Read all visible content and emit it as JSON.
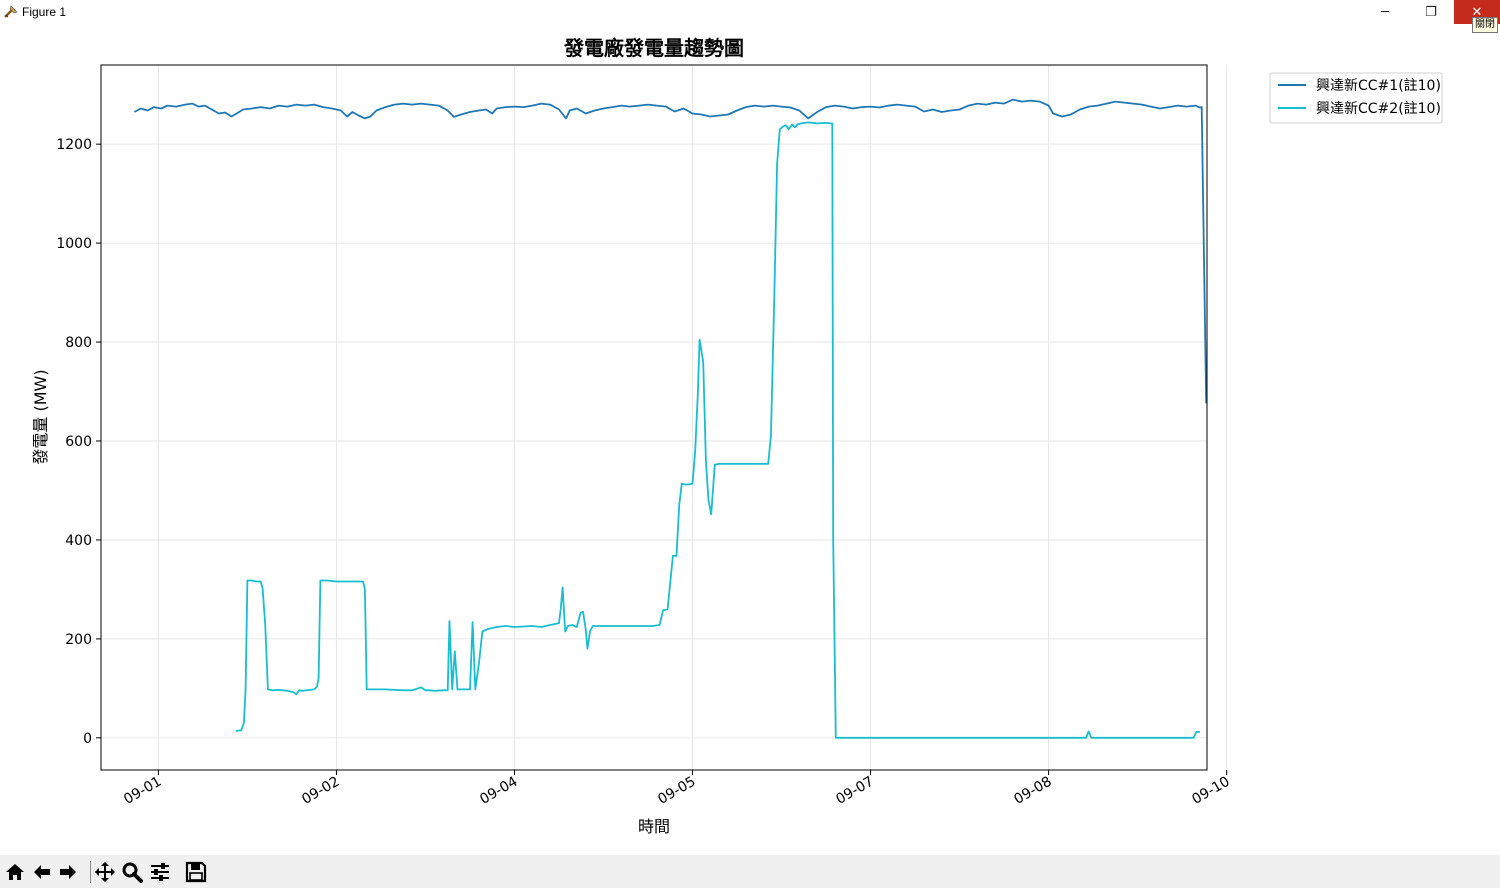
{
  "window": {
    "title": "Figure 1",
    "minimize_glyph": "─",
    "maximize_glyph": "❐",
    "close_glyph": "✕",
    "close_tooltip": "關閉"
  },
  "toolbar": {
    "buttons": [
      "home-icon",
      "back-arrow-icon",
      "forward-arrow-icon",
      "pan-icon",
      "zoom-icon",
      "configure-subplots-icon",
      "save-icon"
    ]
  },
  "chart_data": {
    "type": "line",
    "title": "發電廠發電量趨勢圖",
    "xlabel": "時間",
    "ylabel": "發電量 (MW)",
    "x_unit": "days from 2023-09-01 00:00 (x-axis labels show month-day)",
    "xlim": [
      -0.52,
      9.5
    ],
    "ylim": [
      -65,
      1360
    ],
    "grid": true,
    "legend_position": "upper right outside",
    "xticks": [
      {
        "value": 0,
        "label": "09-01"
      },
      {
        "value": 2,
        "label": "09-02"
      },
      {
        "value": 4,
        "label": "09-04"
      },
      {
        "value": 6,
        "label": "09-05"
      },
      {
        "value": 8,
        "label": "09-07"
      },
      {
        "value": 10,
        "label": "09-08"
      },
      {
        "value": 12,
        "label": "09-10"
      }
    ],
    "yticks": [
      0,
      200,
      400,
      600,
      800,
      1000,
      1200
    ],
    "series": [
      {
        "name": "興達新CC#1(註10)",
        "color": "#1f77b4",
        "points": [
          [
            -0.27,
            1265
          ],
          [
            -0.2,
            1272
          ],
          [
            -0.12,
            1268
          ],
          [
            -0.05,
            1275
          ],
          [
            0.03,
            1272
          ],
          [
            0.1,
            1278
          ],
          [
            0.2,
            1276
          ],
          [
            0.3,
            1280
          ],
          [
            0.38,
            1282
          ],
          [
            0.45,
            1276
          ],
          [
            0.52,
            1278
          ],
          [
            0.6,
            1270
          ],
          [
            0.68,
            1262
          ],
          [
            0.75,
            1264
          ],
          [
            0.82,
            1256
          ],
          [
            0.88,
            1262
          ],
          [
            0.95,
            1270
          ],
          [
            1.05,
            1272
          ],
          [
            1.15,
            1275
          ],
          [
            1.25,
            1272
          ],
          [
            1.35,
            1278
          ],
          [
            1.45,
            1276
          ],
          [
            1.55,
            1280
          ],
          [
            1.65,
            1278
          ],
          [
            1.75,
            1280
          ],
          [
            1.85,
            1275
          ],
          [
            1.95,
            1272
          ],
          [
            2.05,
            1268
          ],
          [
            2.12,
            1256
          ],
          [
            2.18,
            1265
          ],
          [
            2.25,
            1258
          ],
          [
            2.32,
            1252
          ],
          [
            2.38,
            1256
          ],
          [
            2.45,
            1268
          ],
          [
            2.55,
            1275
          ],
          [
            2.65,
            1280
          ],
          [
            2.75,
            1282
          ],
          [
            2.85,
            1280
          ],
          [
            2.95,
            1282
          ],
          [
            3.05,
            1280
          ],
          [
            3.15,
            1278
          ],
          [
            3.25,
            1268
          ],
          [
            3.32,
            1255
          ],
          [
            3.4,
            1260
          ],
          [
            3.5,
            1265
          ],
          [
            3.6,
            1268
          ],
          [
            3.68,
            1270
          ],
          [
            3.75,
            1262
          ],
          [
            3.8,
            1272
          ],
          [
            3.9,
            1275
          ],
          [
            4.0,
            1276
          ],
          [
            4.1,
            1275
          ],
          [
            4.2,
            1278
          ],
          [
            4.3,
            1282
          ],
          [
            4.4,
            1280
          ],
          [
            4.5,
            1270
          ],
          [
            4.58,
            1252
          ],
          [
            4.62,
            1268
          ],
          [
            4.7,
            1272
          ],
          [
            4.8,
            1262
          ],
          [
            4.9,
            1268
          ],
          [
            5.0,
            1272
          ],
          [
            5.1,
            1275
          ],
          [
            5.2,
            1278
          ],
          [
            5.3,
            1276
          ],
          [
            5.4,
            1278
          ],
          [
            5.5,
            1280
          ],
          [
            5.6,
            1278
          ],
          [
            5.7,
            1276
          ],
          [
            5.8,
            1266
          ],
          [
            5.9,
            1272
          ],
          [
            6.0,
            1262
          ],
          [
            6.1,
            1260
          ],
          [
            6.2,
            1256
          ],
          [
            6.3,
            1258
          ],
          [
            6.4,
            1260
          ],
          [
            6.5,
            1268
          ],
          [
            6.6,
            1275
          ],
          [
            6.7,
            1278
          ],
          [
            6.8,
            1276
          ],
          [
            6.9,
            1278
          ],
          [
            7.0,
            1276
          ],
          [
            7.1,
            1274
          ],
          [
            7.2,
            1268
          ],
          [
            7.3,
            1252
          ],
          [
            7.4,
            1265
          ],
          [
            7.5,
            1275
          ],
          [
            7.6,
            1278
          ],
          [
            7.7,
            1276
          ],
          [
            7.8,
            1272
          ],
          [
            7.9,
            1275
          ],
          [
            8.0,
            1276
          ],
          [
            8.1,
            1274
          ],
          [
            8.2,
            1278
          ],
          [
            8.3,
            1280
          ],
          [
            8.4,
            1278
          ],
          [
            8.5,
            1276
          ],
          [
            8.6,
            1266
          ],
          [
            8.7,
            1270
          ],
          [
            8.8,
            1265
          ],
          [
            8.9,
            1268
          ],
          [
            9.0,
            1270
          ],
          [
            9.1,
            1278
          ],
          [
            9.2,
            1282
          ],
          [
            9.3,
            1280
          ],
          [
            9.4,
            1284
          ],
          [
            9.5,
            1282
          ],
          [
            9.6,
            1290
          ],
          [
            9.7,
            1286
          ],
          [
            9.8,
            1288
          ],
          [
            9.9,
            1286
          ],
          [
            10.0,
            1278
          ],
          [
            10.05,
            1262
          ],
          [
            10.15,
            1256
          ],
          [
            10.25,
            1260
          ],
          [
            10.35,
            1270
          ],
          [
            10.45,
            1276
          ],
          [
            10.55,
            1278
          ],
          [
            10.65,
            1282
          ],
          [
            10.75,
            1286
          ],
          [
            10.85,
            1284
          ],
          [
            10.95,
            1282
          ],
          [
            11.05,
            1280
          ],
          [
            11.15,
            1276
          ],
          [
            11.25,
            1272
          ],
          [
            11.35,
            1275
          ],
          [
            11.45,
            1278
          ],
          [
            11.55,
            1276
          ],
          [
            11.65,
            1278
          ],
          [
            11.7,
            1274
          ],
          [
            11.72,
            1275
          ],
          [
            11.77,
            676
          ]
        ]
      },
      {
        "name": "興達新CC#2(註10)",
        "color": "#17becf",
        "points": [
          [
            0.87,
            14
          ],
          [
            0.93,
            15
          ],
          [
            0.96,
            30
          ],
          [
            0.98,
            100
          ],
          [
            1.0,
            318
          ],
          [
            1.05,
            318
          ],
          [
            1.1,
            316
          ],
          [
            1.15,
            316
          ],
          [
            1.17,
            302
          ],
          [
            1.2,
            230
          ],
          [
            1.23,
            98
          ],
          [
            1.28,
            96
          ],
          [
            1.35,
            97
          ],
          [
            1.45,
            95
          ],
          [
            1.52,
            92
          ],
          [
            1.55,
            88
          ],
          [
            1.58,
            96
          ],
          [
            1.62,
            95
          ],
          [
            1.7,
            97
          ],
          [
            1.75,
            98
          ],
          [
            1.78,
            103
          ],
          [
            1.8,
            120
          ],
          [
            1.82,
            318
          ],
          [
            1.9,
            318
          ],
          [
            2.0,
            316
          ],
          [
            2.1,
            316
          ],
          [
            2.2,
            316
          ],
          [
            2.25,
            316
          ],
          [
            2.3,
            316
          ],
          [
            2.32,
            300
          ],
          [
            2.34,
            98
          ],
          [
            2.45,
            98
          ],
          [
            2.55,
            98
          ],
          [
            2.65,
            97
          ],
          [
            2.75,
            96
          ],
          [
            2.85,
            96
          ],
          [
            2.95,
            102
          ],
          [
            3.0,
            96
          ],
          [
            3.05,
            96
          ],
          [
            3.1,
            95
          ],
          [
            3.2,
            96
          ],
          [
            3.25,
            96
          ],
          [
            3.27,
            236
          ],
          [
            3.3,
            98
          ],
          [
            3.33,
            175
          ],
          [
            3.36,
            98
          ],
          [
            3.42,
            98
          ],
          [
            3.48,
            98
          ],
          [
            3.5,
            98
          ],
          [
            3.53,
            234
          ],
          [
            3.56,
            98
          ],
          [
            3.6,
            150
          ],
          [
            3.64,
            215
          ],
          [
            3.7,
            220
          ],
          [
            3.8,
            224
          ],
          [
            3.9,
            226
          ],
          [
            4.0,
            224
          ],
          [
            4.1,
            225
          ],
          [
            4.2,
            226
          ],
          [
            4.3,
            224
          ],
          [
            4.35,
            226
          ],
          [
            4.4,
            228
          ],
          [
            4.45,
            230
          ],
          [
            4.5,
            232
          ],
          [
            4.52,
            262
          ],
          [
            4.54,
            304
          ],
          [
            4.57,
            215
          ],
          [
            4.6,
            226
          ],
          [
            4.65,
            228
          ],
          [
            4.7,
            224
          ],
          [
            4.74,
            252
          ],
          [
            4.77,
            255
          ],
          [
            4.8,
            220
          ],
          [
            4.82,
            180
          ],
          [
            4.85,
            216
          ],
          [
            4.88,
            226
          ],
          [
            4.95,
            226
          ],
          [
            5.05,
            226
          ],
          [
            5.15,
            226
          ],
          [
            5.25,
            226
          ],
          [
            5.35,
            226
          ],
          [
            5.45,
            226
          ],
          [
            5.55,
            226
          ],
          [
            5.63,
            228
          ],
          [
            5.67,
            258
          ],
          [
            5.72,
            260
          ],
          [
            5.78,
            368
          ],
          [
            5.82,
            368
          ],
          [
            5.85,
            470
          ],
          [
            5.88,
            514
          ],
          [
            5.92,
            512
          ],
          [
            5.96,
            512
          ],
          [
            6.0,
            514
          ],
          [
            6.03,
            580
          ],
          [
            6.06,
            700
          ],
          [
            6.08,
            805
          ],
          [
            6.12,
            760
          ],
          [
            6.15,
            560
          ],
          [
            6.18,
            480
          ],
          [
            6.21,
            452
          ],
          [
            6.25,
            552
          ],
          [
            6.3,
            554
          ],
          [
            6.35,
            554
          ],
          [
            6.45,
            554
          ],
          [
            6.55,
            554
          ],
          [
            6.65,
            554
          ],
          [
            6.75,
            554
          ],
          [
            6.85,
            554
          ],
          [
            6.88,
            610
          ],
          [
            6.92,
            900
          ],
          [
            6.95,
            1160
          ],
          [
            6.98,
            1230
          ],
          [
            7.02,
            1236
          ],
          [
            7.05,
            1238
          ],
          [
            7.08,
            1230
          ],
          [
            7.12,
            1240
          ],
          [
            7.15,
            1234
          ],
          [
            7.18,
            1240
          ],
          [
            7.22,
            1242
          ],
          [
            7.3,
            1244
          ],
          [
            7.4,
            1242
          ],
          [
            7.5,
            1243
          ],
          [
            7.55,
            1242
          ],
          [
            7.57,
            1242
          ],
          [
            7.58,
            400
          ],
          [
            7.61,
            0
          ],
          [
            7.8,
            0
          ],
          [
            8.0,
            0
          ],
          [
            8.5,
            0
          ],
          [
            9.0,
            0
          ],
          [
            9.5,
            0
          ],
          [
            10.0,
            0
          ],
          [
            10.35,
            0
          ],
          [
            10.42,
            0
          ],
          [
            10.45,
            13
          ],
          [
            10.48,
            0
          ],
          [
            10.8,
            0
          ],
          [
            11.2,
            0
          ],
          [
            11.58,
            0
          ],
          [
            11.63,
            0
          ],
          [
            11.66,
            12
          ],
          [
            11.7,
            12
          ]
        ]
      }
    ]
  }
}
